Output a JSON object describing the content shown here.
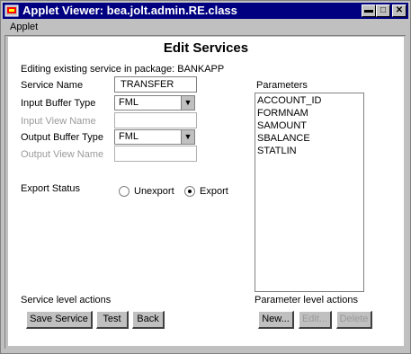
{
  "window": {
    "title": "Applet Viewer: bea.jolt.admin.RE.class"
  },
  "menubar": {
    "items": [
      "Applet"
    ]
  },
  "form": {
    "heading": "Edit Services",
    "package_info": "Editing existing service in package: BANKAPP",
    "service_name_label": "Service Name",
    "service_name_value": "TRANSFER",
    "input_buffer_label": "Input Buffer Type",
    "input_buffer_value": "FML",
    "input_view_label": "Input View Name",
    "output_buffer_label": "Output Buffer Type",
    "output_buffer_value": "FML",
    "output_view_label": "Output View Name",
    "export_status_label": "Export Status",
    "unexport_label": "Unexport",
    "export_label": "Export",
    "export_selected": "Export"
  },
  "parameters": {
    "label": "Parameters",
    "items": [
      "ACCOUNT_ID",
      "FORMNAM",
      "SAMOUNT",
      "SBALANCE",
      "STATLIN"
    ]
  },
  "service_actions": {
    "label": "Service level actions",
    "save": "Save Service",
    "test": "Test",
    "back": "Back"
  },
  "parameter_actions": {
    "label": "Parameter level actions",
    "new": "New...",
    "edit": "Edit...",
    "delete": "Delete"
  }
}
